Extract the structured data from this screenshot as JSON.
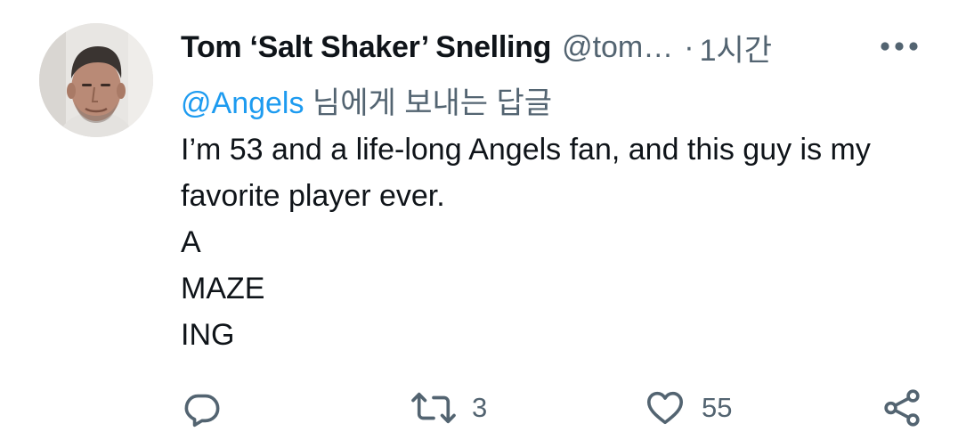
{
  "tweet": {
    "display_name": "Tom ‘Salt Shaker’ Snelling",
    "handle": "@tom…",
    "separator": "·",
    "time": "1시간",
    "reply_to": {
      "mention": "@Angels",
      "suffix": " 님에게 보내는 답글"
    },
    "body_lines": [
      "I’m 53 and a life-long Angels fan, and this guy is my favorite player ever.",
      "A",
      "MAZE",
      "ING"
    ]
  },
  "actions": {
    "reply": {
      "icon": "reply-icon",
      "count": ""
    },
    "retweet": {
      "icon": "retweet-icon",
      "count": "3"
    },
    "like": {
      "icon": "heart-icon",
      "count": "55"
    },
    "share": {
      "icon": "share-icon",
      "count": ""
    }
  },
  "colors": {
    "text_primary": "#0f1419",
    "text_secondary": "#536471",
    "accent": "#1d9bf0",
    "background": "#ffffff"
  }
}
